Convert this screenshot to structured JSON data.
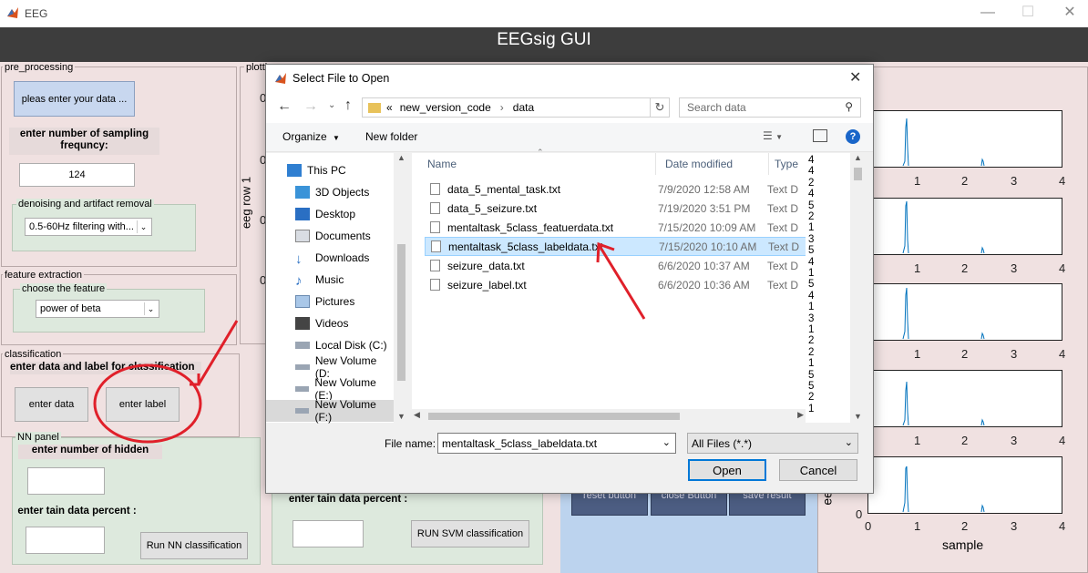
{
  "window": {
    "title": "EEG",
    "min_icon": "minimize-icon",
    "max_icon": "maximize-icon",
    "close_icon": "close-icon"
  },
  "app": {
    "title": "EEGsig GUI"
  },
  "preprocessing": {
    "title": "pre_processing",
    "enter_data_btn": "pleas enter your data ...",
    "sampling_label": "enter number of sampling frequncy:",
    "sampling_value": "124",
    "denoise_title": "denoising and artifact removal",
    "denoise_value": "0.5-60Hz filtering with..."
  },
  "plotting": {
    "title": "plotti",
    "ylabel": "eeg row 1",
    "yticks": [
      "0",
      "0",
      "0",
      "0"
    ]
  },
  "feature": {
    "title": "feature extraction",
    "choose_title": "choose the feature",
    "value": "power of beta"
  },
  "classification": {
    "title": "classification",
    "label": "enter data and label for classification",
    "enter_data_btn": "enter data",
    "enter_label_btn": "enter label"
  },
  "nn_panel": {
    "title": "NN panel",
    "hidden_label": "enter number of hidden",
    "train_label": "enter tain data percent :",
    "run_btn": "Run NN classification"
  },
  "svm_panel": {
    "train_label": "enter tain data percent :",
    "run_btn": "RUN SVM classification"
  },
  "bottom_buttons": [
    "reset button",
    "close Button",
    "save result"
  ],
  "right_chart": {
    "xticks": [
      "1",
      "2",
      "3",
      "4"
    ],
    "bottom_xticks": [
      "0",
      "1",
      "2",
      "3",
      "4"
    ],
    "xlabel": "sample",
    "y0": "0",
    "ylabel_fragment": "eeg"
  },
  "dialog": {
    "title": "Select File to Open",
    "breadcrumb": [
      "«",
      "new_version_code",
      "data"
    ],
    "search_placeholder": "Search data",
    "organize": "Organize",
    "new_folder": "New folder",
    "tree": [
      {
        "label": "This PC",
        "icon": "computer-icon"
      },
      {
        "label": "3D Objects",
        "icon": "3d-objects-icon"
      },
      {
        "label": "Desktop",
        "icon": "desktop-icon"
      },
      {
        "label": "Documents",
        "icon": "documents-icon"
      },
      {
        "label": "Downloads",
        "icon": "downloads-icon"
      },
      {
        "label": "Music",
        "icon": "music-icon"
      },
      {
        "label": "Pictures",
        "icon": "pictures-icon"
      },
      {
        "label": "Videos",
        "icon": "videos-icon"
      },
      {
        "label": "Local Disk (C:)",
        "icon": "drive-icon"
      },
      {
        "label": "New Volume (D:",
        "icon": "drive-icon"
      },
      {
        "label": "New Volume (E:)",
        "icon": "drive-icon"
      },
      {
        "label": "New Volume (F:)",
        "icon": "drive-icon"
      }
    ],
    "columns": [
      "Name",
      "Date modified",
      "Type"
    ],
    "files": [
      {
        "name": "data_5_mental_task.txt",
        "date": "7/9/2020 12:58 AM",
        "type": "Text D"
      },
      {
        "name": "data_5_seizure.txt",
        "date": "7/19/2020 3:51 PM",
        "type": "Text D"
      },
      {
        "name": "mentaltask_5class_featuerdata.txt",
        "date": "7/15/2020 10:09 AM",
        "type": "Text D"
      },
      {
        "name": "mentaltask_5class_labeldata.txt",
        "date": "7/15/2020 10:10 AM",
        "type": "Text D"
      },
      {
        "name": "seizure_data.txt",
        "date": "6/6/2020 10:37 AM",
        "type": "Text D"
      },
      {
        "name": "seizure_label.txt",
        "date": "6/6/2020 10:36 AM",
        "type": "Text D"
      }
    ],
    "preview": [
      "4",
      "4",
      "2",
      "4",
      "5",
      "2",
      "1",
      "3",
      "5",
      "4",
      "1",
      "5",
      "4",
      "1",
      "3",
      "1",
      "2",
      "2",
      "1",
      "5",
      "5",
      "2",
      "1"
    ],
    "file_name_label": "File name:",
    "file_name_value": "mentaltask_5class_labeldata.txt",
    "filter": "All Files (*.*)",
    "open_btn": "Open",
    "cancel_btn": "Cancel"
  }
}
